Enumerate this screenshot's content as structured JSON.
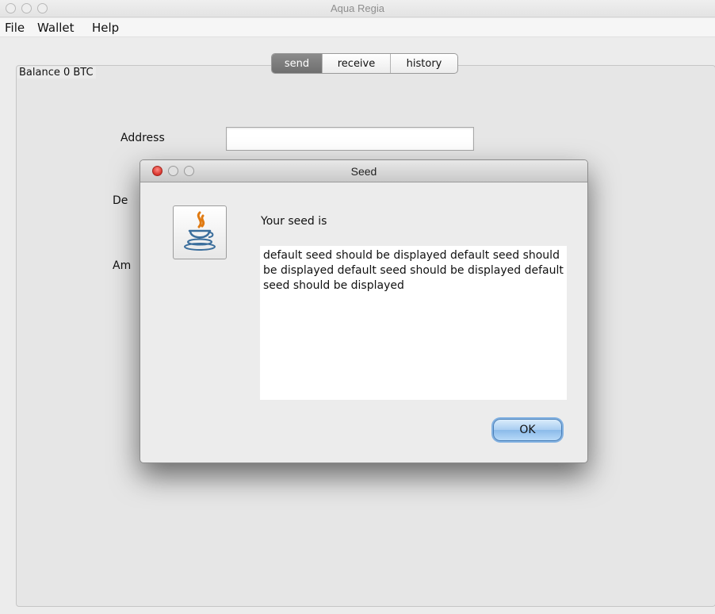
{
  "window": {
    "title": "Aqua Regia"
  },
  "menu": [
    "File",
    "Wallet",
    "Help"
  ],
  "balance": {
    "label": "Balance 0 BTC"
  },
  "tabs": [
    {
      "label": "send",
      "active": true
    },
    {
      "label": "receive",
      "active": false
    },
    {
      "label": "history",
      "active": false
    }
  ],
  "form": {
    "address_label": "Address",
    "description_label_partial": "De",
    "amount_label_partial": "Am",
    "address_value": ""
  },
  "dialog": {
    "title": "Seed",
    "message": "Your seed is",
    "seed": "default seed should be displayed default seed should be displayed default seed should be displayed default seed should be displayed",
    "ok_label": "OK",
    "icon": "java-coffee-icon"
  },
  "colors": {
    "active_tab": "#7c7c7c",
    "ok_button": "#a9cdf1",
    "close_button": "#d7322a"
  }
}
